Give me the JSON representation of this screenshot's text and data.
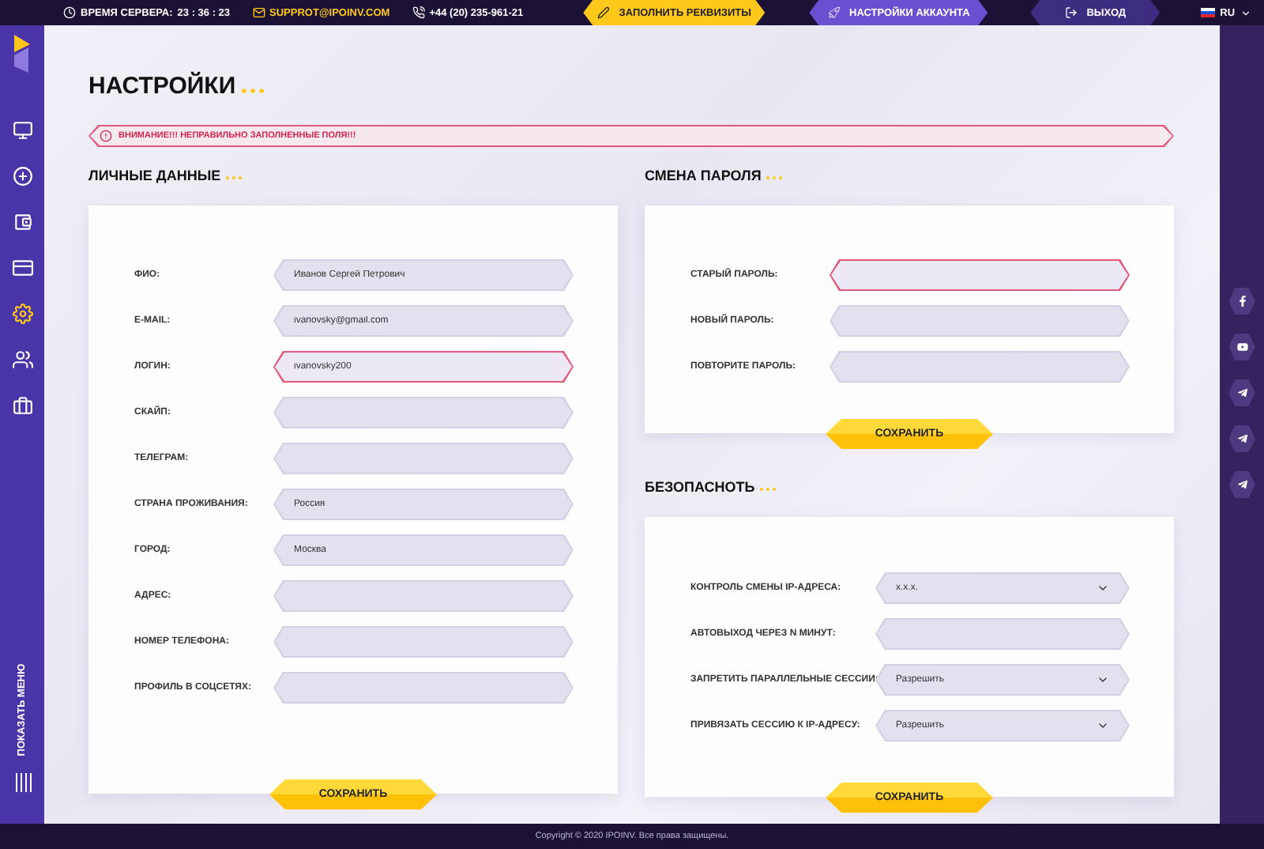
{
  "top_bar": {
    "server_time_label": "ВРЕМЯ СЕРВЕРА:",
    "server_time": "23 : 36 : 23",
    "email": "SUPPROT@IPOINV.COM",
    "phone": "+44 (20) 235-961-21",
    "tabs": [
      {
        "label": "ЗАПОЛНИТЬ РЕКВИЗИТЫ",
        "kind": "accent",
        "selected": false
      },
      {
        "label": "НАСТРОЙКИ АККАУНТА",
        "kind": "nav",
        "selected": true
      },
      {
        "label": "ВЫХОД",
        "kind": "nav",
        "selected": false
      }
    ],
    "language": "RU"
  },
  "sidebar": {
    "items": [
      {
        "selected": false
      },
      {
        "selected": false
      },
      {
        "selected": false
      },
      {
        "selected": false
      },
      {
        "selected": true
      },
      {
        "selected": false
      },
      {
        "selected": false
      }
    ],
    "show_menu": "ПОКАЗАТЬ МЕНЮ"
  },
  "page_title": "НАСТРОЙКИ",
  "alert": "ВНИМАНИЕ!!! НЕПРАВИЛЬНО ЗАПОЛНЕННЫЕ ПОЛЯ!!!",
  "personal": {
    "title": "ЛИЧНЫЕ ДАННЫЕ",
    "fields": [
      {
        "label": "ФИО:",
        "kind": "input",
        "value": "Иванов Сергей Петрович",
        "invalid": false
      },
      {
        "label": "E-MAIL:",
        "kind": "input",
        "value": "ivanovsky@gmail.com",
        "invalid": false
      },
      {
        "label": "ЛОГИН:",
        "kind": "input",
        "value": "ivanovsky200",
        "invalid": true
      },
      {
        "label": "СКАЙП:",
        "kind": "input",
        "invalid": false
      },
      {
        "label": "ТЕЛЕГРАМ:",
        "kind": "input",
        "invalid": false
      },
      {
        "label": "СТРАНА ПРОЖИВАНИЯ:",
        "kind": "input",
        "value": "Россия",
        "invalid": false
      },
      {
        "label": "ГОРОД:",
        "kind": "input",
        "value": "Москва",
        "invalid": false
      },
      {
        "label": "АДРЕС:",
        "kind": "input",
        "invalid": false
      },
      {
        "label": "НОМЕР ТЕЛЕФОНА:",
        "kind": "input",
        "invalid": false
      },
      {
        "label": "ПРОФИЛЬ В СОЦСЕТЯХ:",
        "kind": "input",
        "invalid": false
      }
    ],
    "button": "СОХРАНИТЬ"
  },
  "password": {
    "title": "СМЕНА ПАРОЛЯ",
    "fields": [
      {
        "label": "СТАРЫЙ ПАРОЛЬ:",
        "kind": "input",
        "invalid": true
      },
      {
        "label": "НОВЫЙ ПАРОЛЬ:",
        "kind": "input",
        "invalid": false
      },
      {
        "label": "ПОВТОРИТЕ ПАРОЛЬ:",
        "kind": "input",
        "invalid": false
      }
    ],
    "button": "СОХРАНИТЬ"
  },
  "security": {
    "title": "БЕЗОПАСНОТЬ",
    "fields": [
      {
        "label": "КОНТРОЛЬ СМЕНЫ IP-АДРЕСА:",
        "kind": "select",
        "value": "x.x.x.",
        "invalid": false
      },
      {
        "label": "АВТОВЫХОД ЧЕРЕЗ N МИНУТ:",
        "kind": "input",
        "invalid": false
      },
      {
        "label": "ЗАПРЕТИТЬ ПАРАЛЛЕЛЬНЫЕ СЕССИИ:",
        "kind": "select",
        "value": "Разрешить",
        "invalid": false
      },
      {
        "label": "ПРИВЯЗАТЬ СЕССИЮ К IP-АДРЕСУ:",
        "kind": "select",
        "value": "Разрешить",
        "invalid": false
      }
    ],
    "button": "СОХРАНИТЬ"
  },
  "footer": "Copyright © 2020 IPOINV. Все права защищены."
}
